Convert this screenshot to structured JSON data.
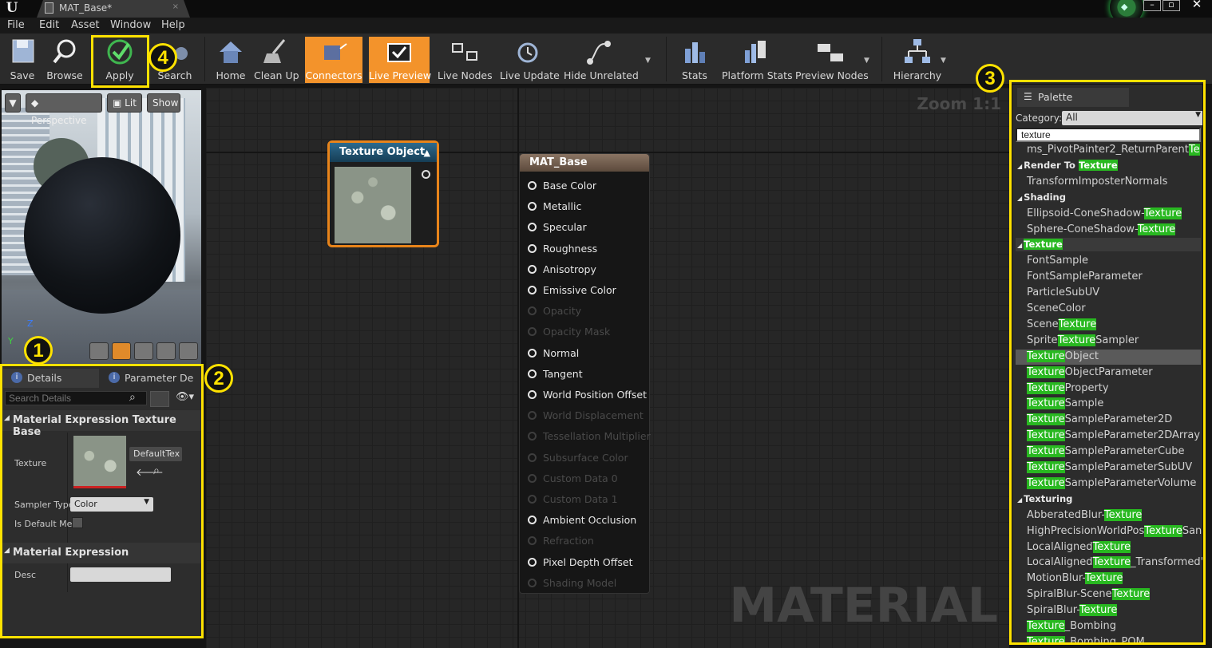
{
  "window": {
    "title": "MAT_Base*"
  },
  "menu": [
    "File",
    "Edit",
    "Asset",
    "Window",
    "Help"
  ],
  "toolbar": {
    "save": "Save",
    "browse": "Browse",
    "apply": "Apply",
    "search": "Search",
    "home": "Home",
    "cleanup": "Clean Up",
    "connectors": "Connectors",
    "live_preview": "Live Preview",
    "live_nodes": "Live Nodes",
    "live_update": "Live Update",
    "hide_unrelated": "Hide Unrelated",
    "stats": "Stats",
    "platform_stats": "Platform Stats",
    "preview_nodes": "Preview Nodes",
    "hierarchy": "Hierarchy"
  },
  "annotations": [
    "1",
    "2",
    "3",
    "4"
  ],
  "viewport": {
    "perspective": "Perspective",
    "lit": "Lit",
    "show": "Show",
    "axis_z": "Z",
    "axis_y": "Y"
  },
  "details": {
    "tab1": "Details",
    "tab2": "Parameter De",
    "search_placeholder": "Search Details",
    "section1": "Material Expression Texture Base",
    "texture_label": "Texture",
    "texture_value": "DefaultTex",
    "sampler_label": "Sampler Type",
    "sampler_value": "Color",
    "default_mesh_label": "Is Default Mes",
    "section2": "Material Expression",
    "desc_label": "Desc"
  },
  "graph": {
    "zoom": "Zoom 1:1",
    "watermark": "MATERIAL",
    "texture_node_title": "Texture Object",
    "material_node_title": "MAT_Base",
    "pins": [
      {
        "label": "Base Color",
        "enabled": true
      },
      {
        "label": "Metallic",
        "enabled": true
      },
      {
        "label": "Specular",
        "enabled": true
      },
      {
        "label": "Roughness",
        "enabled": true
      },
      {
        "label": "Anisotropy",
        "enabled": true
      },
      {
        "label": "Emissive Color",
        "enabled": true
      },
      {
        "label": "Opacity",
        "enabled": false
      },
      {
        "label": "Opacity Mask",
        "enabled": false
      },
      {
        "label": "Normal",
        "enabled": true
      },
      {
        "label": "Tangent",
        "enabled": true
      },
      {
        "label": "World Position Offset",
        "enabled": true
      },
      {
        "label": "World Displacement",
        "enabled": false
      },
      {
        "label": "Tessellation Multiplier",
        "enabled": false
      },
      {
        "label": "Subsurface Color",
        "enabled": false
      },
      {
        "label": "Custom Data 0",
        "enabled": false
      },
      {
        "label": "Custom Data 1",
        "enabled": false
      },
      {
        "label": "Ambient Occlusion",
        "enabled": true
      },
      {
        "label": "Refraction",
        "enabled": false
      },
      {
        "label": "Pixel Depth Offset",
        "enabled": true
      },
      {
        "label": "Shading Model",
        "enabled": false
      }
    ]
  },
  "palette": {
    "tab": "Palette",
    "category_label": "Category:",
    "category_value": "All",
    "search_value": "texture",
    "rows": [
      {
        "kind": "item",
        "parts": [
          [
            "ms_PivotPainter2_ReturnParent",
            false
          ],
          [
            "Te",
            true
          ]
        ]
      },
      {
        "kind": "cat",
        "parts": [
          [
            "Render To ",
            false
          ],
          [
            "Texture",
            true
          ]
        ]
      },
      {
        "kind": "item",
        "parts": [
          [
            "TransformImposterNormals",
            false
          ]
        ]
      },
      {
        "kind": "cat",
        "parts": [
          [
            "Shading",
            false
          ]
        ]
      },
      {
        "kind": "item",
        "parts": [
          [
            "Ellipsoid-ConeShadow-",
            false
          ],
          [
            "Texture",
            true
          ]
        ]
      },
      {
        "kind": "item",
        "parts": [
          [
            "Sphere-ConeShadow-",
            false
          ],
          [
            "Texture",
            true
          ]
        ]
      },
      {
        "kind": "cat",
        "parts": [
          [
            "Texture",
            true
          ]
        ],
        "bar": true
      },
      {
        "kind": "item",
        "parts": [
          [
            "FontSample",
            false
          ]
        ]
      },
      {
        "kind": "item",
        "parts": [
          [
            "FontSampleParameter",
            false
          ]
        ]
      },
      {
        "kind": "item",
        "parts": [
          [
            "ParticleSubUV",
            false
          ]
        ]
      },
      {
        "kind": "item",
        "parts": [
          [
            "SceneColor",
            false
          ]
        ]
      },
      {
        "kind": "item",
        "parts": [
          [
            "Scene",
            false
          ],
          [
            "Texture",
            true
          ]
        ]
      },
      {
        "kind": "item",
        "parts": [
          [
            "Sprite",
            false
          ],
          [
            "Texture",
            true
          ],
          [
            "Sampler",
            false
          ]
        ]
      },
      {
        "kind": "item",
        "parts": [
          [
            "Texture",
            true
          ],
          [
            "Object",
            false
          ]
        ],
        "selected": true
      },
      {
        "kind": "item",
        "parts": [
          [
            "Texture",
            true
          ],
          [
            "ObjectParameter",
            false
          ]
        ]
      },
      {
        "kind": "item",
        "parts": [
          [
            "Texture",
            true
          ],
          [
            "Property",
            false
          ]
        ]
      },
      {
        "kind": "item",
        "parts": [
          [
            "Texture",
            true
          ],
          [
            "Sample",
            false
          ]
        ]
      },
      {
        "kind": "item",
        "parts": [
          [
            "Texture",
            true
          ],
          [
            "SampleParameter2D",
            false
          ]
        ]
      },
      {
        "kind": "item",
        "parts": [
          [
            "Texture",
            true
          ],
          [
            "SampleParameter2DArray",
            false
          ]
        ]
      },
      {
        "kind": "item",
        "parts": [
          [
            "Texture",
            true
          ],
          [
            "SampleParameterCube",
            false
          ]
        ]
      },
      {
        "kind": "item",
        "parts": [
          [
            "Texture",
            true
          ],
          [
            "SampleParameterSubUV",
            false
          ]
        ]
      },
      {
        "kind": "item",
        "parts": [
          [
            "Texture",
            true
          ],
          [
            "SampleParameterVolume",
            false
          ]
        ]
      },
      {
        "kind": "cat",
        "parts": [
          [
            "Texturing",
            false
          ]
        ]
      },
      {
        "kind": "item",
        "parts": [
          [
            "AbberatedBlur-",
            false
          ],
          [
            "Texture",
            true
          ]
        ]
      },
      {
        "kind": "item",
        "parts": [
          [
            "HighPrecisionWorldPos",
            false
          ],
          [
            "Texture",
            true
          ],
          [
            "San",
            false
          ]
        ]
      },
      {
        "kind": "item",
        "parts": [
          [
            "LocalAligned",
            false
          ],
          [
            "Texture",
            true
          ]
        ]
      },
      {
        "kind": "item",
        "parts": [
          [
            "LocalAligned",
            false
          ],
          [
            "Texture",
            true
          ],
          [
            "_Transformed'",
            false
          ]
        ]
      },
      {
        "kind": "item",
        "parts": [
          [
            "MotionBlur-",
            false
          ],
          [
            "Texture",
            true
          ]
        ]
      },
      {
        "kind": "item",
        "parts": [
          [
            "SpiralBlur-Scene",
            false
          ],
          [
            "Texture",
            true
          ]
        ]
      },
      {
        "kind": "item",
        "parts": [
          [
            "SpiralBlur-",
            false
          ],
          [
            "Texture",
            true
          ]
        ]
      },
      {
        "kind": "item",
        "parts": [
          [
            "Texture",
            true
          ],
          [
            "_Bombing",
            false
          ]
        ]
      },
      {
        "kind": "item",
        "parts": [
          [
            "Texture",
            true
          ],
          [
            "_Bombing_POM",
            false
          ]
        ]
      }
    ]
  },
  "colors": {
    "accent": "#f3932b",
    "annotation": "#ffe200",
    "highlight": "#28b820"
  }
}
